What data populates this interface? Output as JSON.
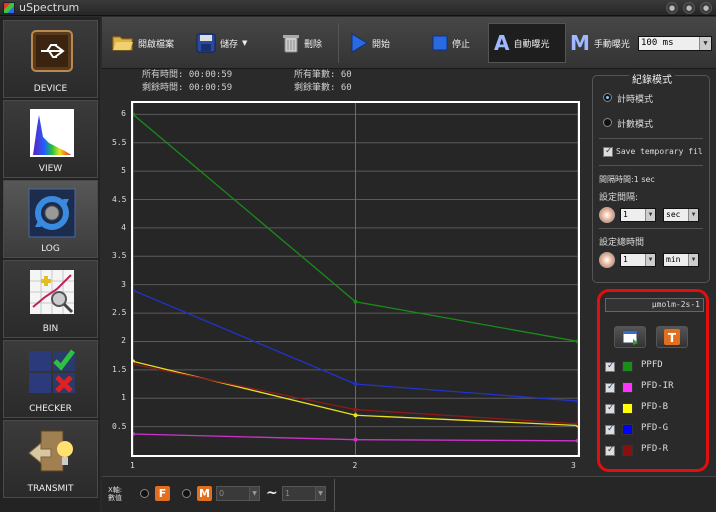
{
  "app": {
    "title": "uSpectrum"
  },
  "sidebar": {
    "items": [
      {
        "label": "DEVICE",
        "icon": "usb-device-icon"
      },
      {
        "label": "VIEW",
        "icon": "spectrum-view-icon"
      },
      {
        "label": "LOG",
        "icon": "log-refresh-icon",
        "active": true
      },
      {
        "label": "BIN",
        "icon": "bin-chart-icon"
      },
      {
        "label": "CHECKER",
        "icon": "checker-icon"
      },
      {
        "label": "TRANSMIT",
        "icon": "transmit-icon"
      }
    ]
  },
  "toolbar": {
    "open_label": "開啟檔案",
    "save_label": "儲存",
    "delete_label": "刪除",
    "start_label": "開始",
    "stop_label": "停止",
    "auto_letter": "A",
    "auto_label": "自動曝光",
    "manual_letter": "M",
    "manual_label": "手動曝光",
    "exposure_value": "100 ms"
  },
  "info": {
    "total_time_label": "所有時間:",
    "total_time": "00:00:59",
    "total_count_label": "所有筆數:",
    "total_count": "60",
    "remaining_time_label": "剩餘時間:",
    "remaining_time": "00:00:59",
    "remaining_count_label": "剩餘筆數:",
    "remaining_count": "60"
  },
  "record_mode": {
    "title": "紀錄模式",
    "timed_label": "計時模式",
    "count_label": "計數模式",
    "save_temp_label": "Save temporary fil",
    "interval_label": "間隔時間:1  sec",
    "set_interval_label": "設定間隔:",
    "interval_value": "1",
    "interval_unit": "sec",
    "set_total_label": "設定總時間",
    "total_value": "1",
    "total_unit": "min"
  },
  "legend": {
    "unit": "μmolm-2s-1",
    "items": [
      {
        "name": "PPFD",
        "color": "#1a8c1a"
      },
      {
        "name": "PFD-IR",
        "color": "#ff33ff"
      },
      {
        "name": "PFD-B",
        "color": "#ffff00"
      },
      {
        "name": "PFD-G",
        "color": "#0000ff"
      },
      {
        "name": "PFD-R",
        "color": "#8b0f0f"
      }
    ]
  },
  "bottom": {
    "label_line1": "X軸:",
    "label_line2": "數值",
    "f_letter": "F",
    "m_letter": "M",
    "from_value": "0",
    "tilde": "~",
    "to_value": "1"
  },
  "chart_data": {
    "type": "line",
    "x": [
      1,
      2,
      3
    ],
    "xlim": [
      1,
      3
    ],
    "ylim": [
      0,
      6.2
    ],
    "yticks": [
      "0.5",
      "1",
      "1.5",
      "2",
      "2.5",
      "3",
      "3.5",
      "4",
      "4.5",
      "5",
      "5.5",
      "6"
    ],
    "xticks": [
      "1",
      "2",
      "3"
    ],
    "grid": true,
    "series": [
      {
        "name": "PPFD",
        "color": "#1a8c1a",
        "values": [
          6.0,
          2.7,
          2.0
        ]
      },
      {
        "name": "PFD-IR",
        "color": "#cc33cc",
        "values": [
          0.37,
          0.27,
          0.25
        ]
      },
      {
        "name": "PFD-B",
        "color": "#e8e020",
        "values": [
          1.65,
          0.7,
          0.52
        ]
      },
      {
        "name": "PFD-G",
        "color": "#2233cc",
        "values": [
          2.9,
          1.25,
          0.95
        ]
      },
      {
        "name": "PFD-R",
        "color": "#8b1a1a",
        "values": [
          1.6,
          0.8,
          0.55
        ]
      }
    ]
  }
}
